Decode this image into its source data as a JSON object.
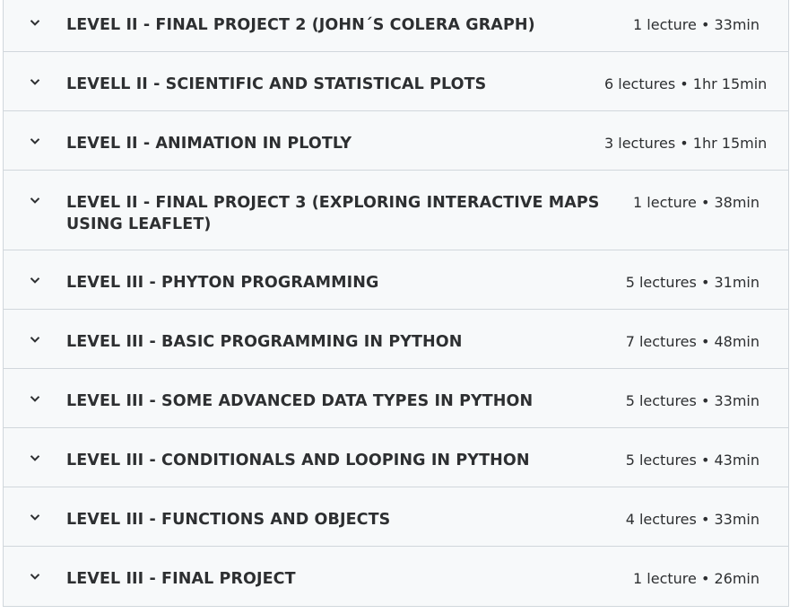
{
  "curriculum": {
    "sections": [
      {
        "title": "LEVEL II - FINAL PROJECT 2 (JOHN´S COLERA GRAPH)",
        "meta": "1 lecture • 33min",
        "icon": "chevron-down-icon"
      },
      {
        "title": "LEVELL II - SCIENTIFIC AND STATISTICAL PLOTS",
        "meta": "6 lectures • 1hr 15min",
        "icon": "chevron-down-icon"
      },
      {
        "title": "LEVEL II - ANIMATION IN PLOTLY",
        "meta": "3 lectures • 1hr 15min",
        "icon": "chevron-down-icon"
      },
      {
        "title": "LEVEL II - FINAL PROJECT 3 (EXPLORING INTERACTIVE MAPS USING LEAFLET)",
        "meta": "1 lecture • 38min",
        "icon": "chevron-down-icon"
      },
      {
        "title": "LEVEL III - PHYTON PROGRAMMING",
        "meta": "5 lectures • 31min",
        "icon": "chevron-down-icon"
      },
      {
        "title": "LEVEL III - BASIC PROGRAMMING IN PYTHON",
        "meta": "7 lectures • 48min",
        "icon": "chevron-down-icon"
      },
      {
        "title": "LEVEL III - SOME ADVANCED DATA TYPES IN PYTHON",
        "meta": "5 lectures • 33min",
        "icon": "chevron-down-icon"
      },
      {
        "title": "LEVEL III - CONDITIONALS AND LOOPING IN PYTHON",
        "meta": "5 lectures • 43min",
        "icon": "chevron-down-icon"
      },
      {
        "title": "LEVEL III - FUNCTIONS AND OBJECTS",
        "meta": "4 lectures • 33min",
        "icon": "chevron-down-icon"
      },
      {
        "title": "LEVEL III - FINAL PROJECT",
        "meta": "1 lecture • 26min",
        "icon": "chevron-down-icon"
      }
    ]
  }
}
